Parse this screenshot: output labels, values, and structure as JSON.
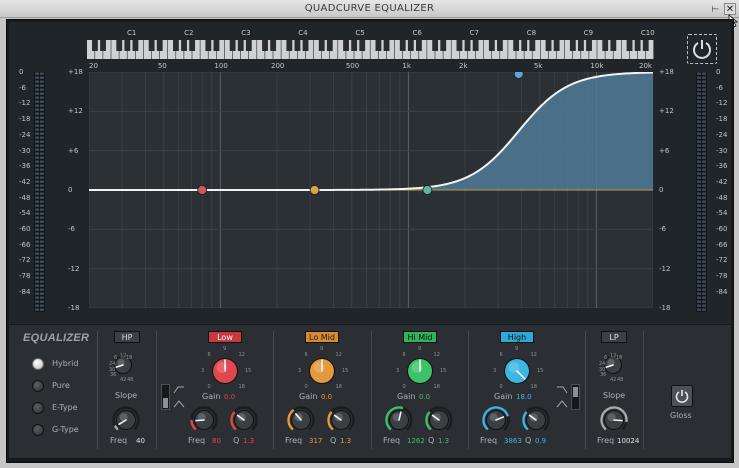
{
  "window": {
    "title": "QUADCURVE EQUALIZER",
    "pin_glyph": "⊢",
    "close_glyph": "✕"
  },
  "piano": {
    "notes": [
      "C1",
      "C2",
      "C3",
      "C4",
      "C5",
      "C6",
      "C7",
      "C8",
      "C9",
      "C10"
    ]
  },
  "frequency_axis": {
    "labels": [
      "20",
      "50",
      "100",
      "200",
      "500",
      "1k",
      "2k",
      "5k",
      "10k",
      "20k"
    ]
  },
  "gain_axis": {
    "labels": [
      "+18",
      "+12",
      "+6",
      "0",
      "-6",
      "-12",
      "-18"
    ]
  },
  "meter_scale": {
    "labels": [
      "0",
      "-6",
      "-12",
      "-18",
      "-24",
      "-30",
      "-36",
      "-42",
      "-48",
      "-54",
      "-60",
      "-66",
      "-72",
      "-78",
      "-84"
    ]
  },
  "curve_points": [
    {
      "band": "low",
      "color": "#d0575d"
    },
    {
      "band": "lo_mid",
      "color": "#d8a540"
    },
    {
      "band": "hi_mid",
      "color": "#5fb39a"
    },
    {
      "band": "high",
      "color": "#5aa7cf"
    }
  ],
  "equalizer": {
    "title": "EQUALIZER",
    "modes": [
      {
        "label": "Hybrid",
        "active": true
      },
      {
        "label": "Pure",
        "active": false
      },
      {
        "label": "E-Type",
        "active": false
      },
      {
        "label": "G-Type",
        "active": false
      }
    ],
    "gloss_label": "Gloss"
  },
  "hp": {
    "button": "HP",
    "slope_label": "Slope",
    "slope_marks": [
      "12",
      "6",
      "18",
      "24",
      "30",
      "36",
      "42",
      "48"
    ],
    "freq_label": "Freq",
    "freq_value": "40"
  },
  "lp": {
    "button": "LP",
    "slope_label": "Slope",
    "slope_marks": [
      "12",
      "6",
      "18",
      "24",
      "30",
      "36",
      "42",
      "48"
    ],
    "freq_label": "Freq",
    "freq_value": "10024"
  },
  "bands": [
    {
      "id": "low",
      "button": "Low",
      "color": "#e0474f",
      "btn_bg": "#c9383f",
      "btn_text": "#ffffff",
      "gain_label": "Gain",
      "gain_value": "0.0",
      "freq_label": "Freq",
      "freq_value": "80",
      "q_label": "Q",
      "q_value": "1.3",
      "gain_marks": [
        "0",
        "3",
        "6",
        "9",
        "12",
        "15",
        "18"
      ]
    },
    {
      "id": "lo_mid",
      "button": "Lo Mid",
      "color": "#e29a3d",
      "btn_bg": "#d98a32",
      "btn_text": "#1d1d1d",
      "gain_label": "Gain",
      "gain_value": "0.0",
      "freq_label": "Freq",
      "freq_value": "317",
      "q_label": "Q",
      "q_value": "1.3",
      "gain_marks": [
        "0",
        "3",
        "6",
        "9",
        "12",
        "15",
        "18"
      ]
    },
    {
      "id": "hi_mid",
      "button": "Hi Mid",
      "color": "#3cc36a",
      "btn_bg": "#2fb35c",
      "btn_text": "#0d0d0d",
      "gain_label": "Gain",
      "gain_value": "0.0",
      "freq_label": "Freq",
      "freq_value": "1262",
      "q_label": "Q",
      "q_value": "1.3",
      "gain_marks": [
        "0",
        "3",
        "6",
        "9",
        "12",
        "15",
        "18"
      ]
    },
    {
      "id": "high",
      "button": "High",
      "color": "#3bb6e0",
      "btn_bg": "#2ea8d6",
      "btn_text": "#0d0d0d",
      "gain_label": "Gain",
      "gain_value": "18.0",
      "freq_label": "Freq",
      "freq_value": "3863",
      "q_label": "Q",
      "q_value": "0.9",
      "gain_marks": [
        "0",
        "3",
        "6",
        "9",
        "12",
        "15",
        "18"
      ]
    }
  ]
}
